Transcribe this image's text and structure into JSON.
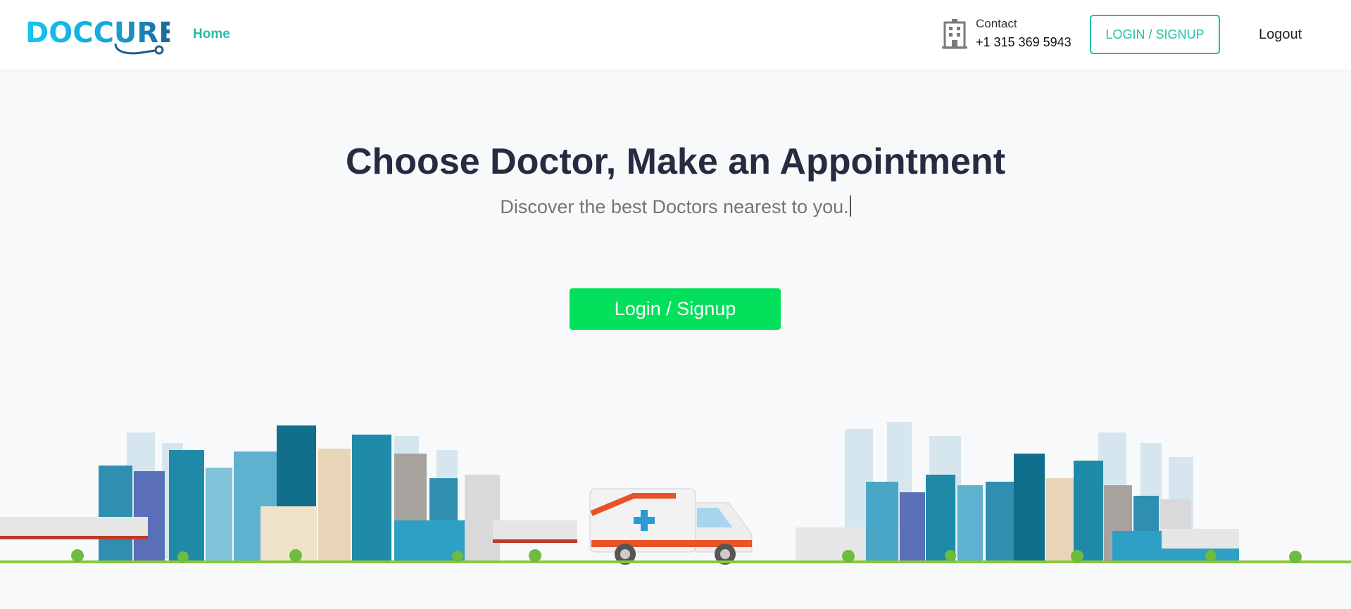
{
  "header": {
    "logo_text": "DOCCURE",
    "nav": {
      "home_label": "Home"
    },
    "contact": {
      "label": "Contact",
      "phone": "+1 315 369 5943"
    },
    "login_signup_label": "LOGIN / SIGNUP",
    "logout_label": "Logout"
  },
  "hero": {
    "title": "Choose Doctor, Make an Appointment",
    "subtitle": "Discover the best Doctors nearest to you.",
    "cta_label": "Login / Signup"
  },
  "colors": {
    "brand_teal": "#20c0a3",
    "cta_green": "#04e05b",
    "title_navy": "#272b41",
    "logo_cyan": "#15c6ed",
    "logo_navy": "#1e5e92"
  },
  "icons": {
    "contact": "building-icon",
    "logo_mark": "stethoscope-icon"
  }
}
